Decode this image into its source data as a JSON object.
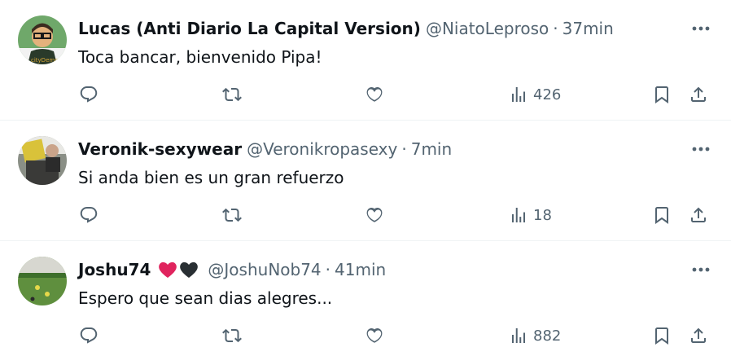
{
  "replies": [
    {
      "display_name": "Lucas (Anti Diario La Capital Version)",
      "handle": "@NiatoLeproso",
      "separator": "·",
      "time": "37min",
      "text": "Toca bancar, bienvenido Pipa!",
      "views": "426",
      "avatar_colors": {
        "bg": "#6fa86a",
        "accent": "#2a3a2a"
      }
    },
    {
      "display_name": "Veronik-sexywear",
      "handle": "@Veronikropasexy",
      "separator": "·",
      "time": "7min",
      "text": "Si anda bien es un gran refuerzo",
      "views": "18",
      "avatar_colors": {
        "bg": "#8a8f86",
        "accent": "#d9c23a"
      }
    },
    {
      "display_name": "Joshu74",
      "name_emojis": [
        "red-heart",
        "black-heart"
      ],
      "handle": "@JoshuNob74",
      "separator": "·",
      "time": "41min",
      "text": "Espero que sean dias alegres...",
      "views": "882",
      "avatar_colors": {
        "bg": "#5f8f3e",
        "accent": "#d7d7d0"
      }
    }
  ],
  "colors": {
    "text": "#0f1419",
    "secondary": "#536471",
    "divider": "#eff3f4",
    "heart_red": "#e0245e",
    "heart_black": "#292f33"
  },
  "icons": [
    "reply-icon",
    "retweet-icon",
    "like-icon",
    "views-icon",
    "bookmark-icon",
    "share-icon",
    "more-icon"
  ]
}
